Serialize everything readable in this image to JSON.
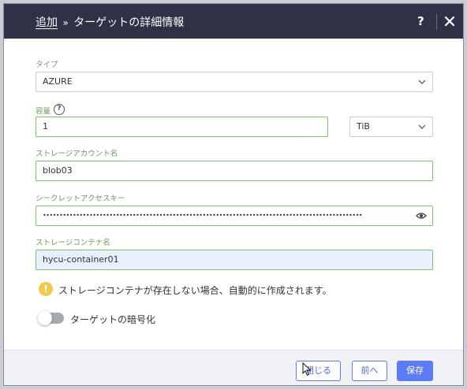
{
  "header": {
    "breadcrumb_link": "追加",
    "separator": "»",
    "title": "ターゲットの詳細情報",
    "help_label": "?"
  },
  "form": {
    "type_label": "タイプ",
    "type_value": "AZURE",
    "capacity_label": "容量",
    "capacity_help": "?",
    "capacity_value": "1",
    "capacity_unit": "TiB",
    "account_label": "ストレージアカウント名",
    "account_value": "blob03",
    "secret_label": "シークレットアクセスキー",
    "secret_value": "••••••••••••••••••••••••••••••••••••••••••••••••••••••••••••••••••••••••••••••••••••••••••••••••",
    "container_label": "ストレージコンテナ名",
    "container_value": "hycu-container01",
    "warning_icon": "!",
    "warning_text": "ストレージコンテナが存在しない場合、自動的に作成されます。",
    "encrypt_label": "ターゲットの暗号化",
    "encrypt_enabled": false
  },
  "footer": {
    "close_label": "閉じる",
    "back_label": "前へ",
    "save_label": "保存"
  },
  "colors": {
    "header_bg": "#2f3146",
    "accent": "#5b7cf5",
    "valid_border": "#7dc36d",
    "warning": "#f2c94c"
  }
}
